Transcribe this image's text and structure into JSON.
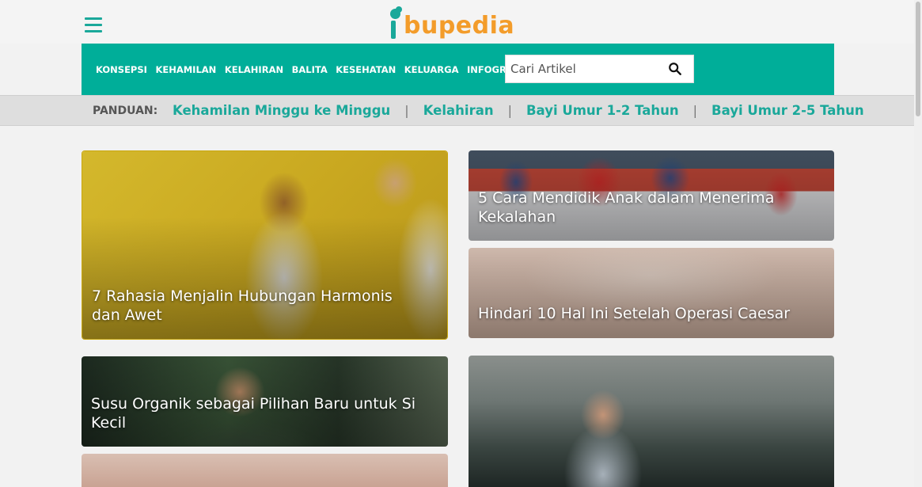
{
  "header": {
    "logo_text": "ibupedia",
    "menu_icon": "hamburger-menu-icon"
  },
  "nav": {
    "items": [
      "KONSEPSI",
      "KEHAMILAN",
      "KELAHIRAN",
      "BALITA",
      "KESEHATAN",
      "KELUARGA",
      "INFOGRAFIS"
    ],
    "search_placeholder": "Cari Artikel",
    "search_icon": "search-icon"
  },
  "guide": {
    "label": "PANDUAN:",
    "links": [
      "Kehamilan Minggu ke Minggu",
      "Kelahiran",
      "Bayi Umur 1-2 Tahun",
      "Bayi Umur 2-5 Tahun"
    ],
    "separator": "|"
  },
  "articles": [
    {
      "title": "7 Rahasia Menjalin Hubungan Harmonis dan Awet"
    },
    {
      "title": "5 Cara Mendidik Anak dalam Menerima Kekalahan"
    },
    {
      "title": "Hindari 10 Hal Ini Setelah Operasi Caesar"
    },
    {
      "title": "Susu Organik sebagai Pilihan Baru untuk Si Kecil"
    },
    {
      "title": ""
    },
    {
      "title": ""
    }
  ],
  "colors": {
    "brand_teal": "#00ae99",
    "logo_orange": "#f39c2a",
    "guide_link": "#1aa89a"
  }
}
